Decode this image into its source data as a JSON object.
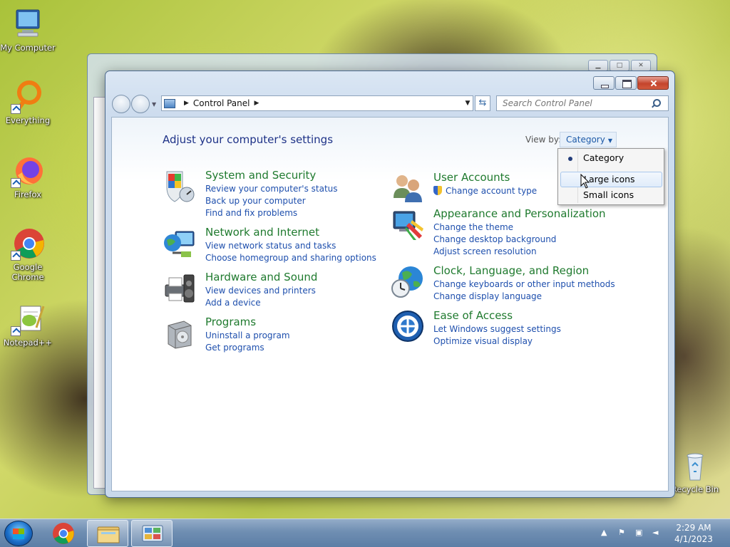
{
  "desktop": {
    "icons": [
      {
        "label": "My Computer"
      },
      {
        "label": "Everything"
      },
      {
        "label": "Firefox"
      },
      {
        "label": "Google Chrome"
      },
      {
        "label": "Notepad++"
      },
      {
        "label": "Recycle Bin"
      }
    ]
  },
  "window": {
    "breadcrumb": [
      "Control Panel"
    ],
    "search_placeholder": "Search Control Panel",
    "heading": "Adjust your computer's settings",
    "view_by_label": "View by:",
    "view_by_value": "Category",
    "categories": [
      {
        "title": "System and Security",
        "icon": "shield-icon",
        "links": [
          "Review your computer's status",
          "Back up your computer",
          "Find and fix problems"
        ]
      },
      {
        "title": "Network and Internet",
        "icon": "globe-network-icon",
        "links": [
          "View network status and tasks",
          "Choose homegroup and sharing options"
        ]
      },
      {
        "title": "Hardware and Sound",
        "icon": "printer-speaker-icon",
        "links": [
          "View devices and printers",
          "Add a device"
        ]
      },
      {
        "title": "Programs",
        "icon": "programs-box-icon",
        "links": [
          "Uninstall a program",
          "Get programs"
        ]
      },
      {
        "title": "User Accounts",
        "icon": "users-icon",
        "links": [
          "Change account type"
        ]
      },
      {
        "title": "Appearance and Personalization",
        "icon": "monitor-palette-icon",
        "links": [
          "Change the theme",
          "Change desktop background",
          "Adjust screen resolution"
        ]
      },
      {
        "title": "Clock, Language, and Region",
        "icon": "globe-clock-icon",
        "links": [
          "Change keyboards or other input methods",
          "Change display language"
        ]
      },
      {
        "title": "Ease of Access",
        "icon": "ease-of-access-icon",
        "links": [
          "Let Windows suggest settings",
          "Optimize visual display"
        ]
      }
    ]
  },
  "view_menu": {
    "items": [
      {
        "label": "Category",
        "selected": true
      },
      {
        "label": "Large icons",
        "hovered": true
      },
      {
        "label": "Small icons"
      }
    ]
  },
  "taskbar": {
    "time": "2:29 AM",
    "date": "4/1/2023"
  }
}
